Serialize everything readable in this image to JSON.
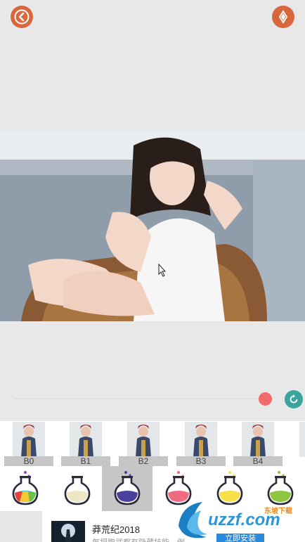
{
  "toolbar": {
    "back_icon": "back-arrow-icon",
    "download_icon": "download-icon",
    "accent_color": "#d9673d"
  },
  "filters": [
    {
      "label": "B0"
    },
    {
      "label": "B1"
    },
    {
      "label": "B2"
    },
    {
      "label": "B3"
    },
    {
      "label": "B4"
    }
  ],
  "tools": [
    {
      "icon": "rainbow-flask-icon",
      "color": "#3ac"
    },
    {
      "icon": "cream-flask-icon",
      "color": "#f0e6c8"
    },
    {
      "icon": "blue-flask-icon",
      "color": "#4a3f9a",
      "selected": true
    },
    {
      "icon": "pink-flask-icon",
      "color": "#f06a80"
    },
    {
      "icon": "yellow-flask-icon",
      "color": "#f5e14a"
    },
    {
      "icon": "green-flask-icon",
      "color": "#8cc63f"
    }
  ],
  "slider": {
    "value": 0.9,
    "knob_color": "#f26b6b"
  },
  "ad": {
    "title": "莽荒纪2018",
    "subtitle": "每把跑武都有隐藏技能，例",
    "install_label": "立即安装"
  },
  "watermark": {
    "text": "uzzf.com",
    "small": "东坡下载"
  }
}
